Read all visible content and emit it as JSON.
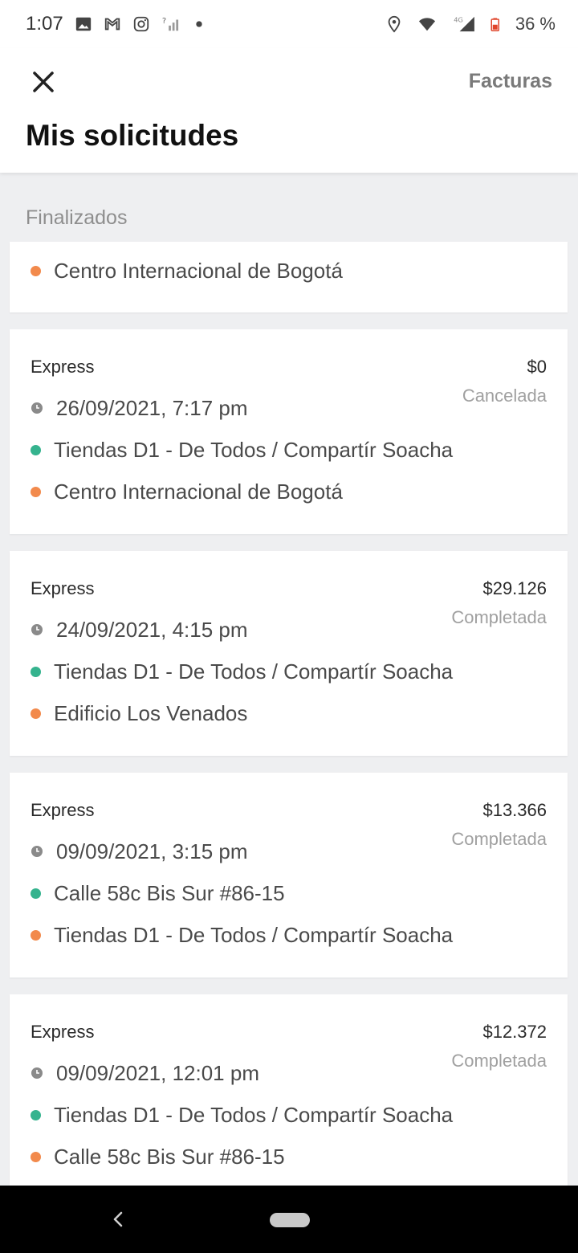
{
  "status_bar": {
    "time": "1:07",
    "battery_text": "36 %",
    "network": "4G",
    "left_icons": [
      "image-icon",
      "gmail-icon",
      "instagram-icon",
      "no-signal-icon",
      "dot-icon"
    ],
    "right_icons": [
      "location-icon",
      "wifi-icon",
      "signal-icon",
      "battery-icon"
    ]
  },
  "header": {
    "close_icon": "close-icon",
    "facturas_label": "Facturas",
    "title": "Mis solicitudes"
  },
  "section": {
    "label": "Finalizados"
  },
  "partial_card": {
    "destination": "Centro Internacional de Bogotá"
  },
  "cards": [
    {
      "type": "Express",
      "price": "$0",
      "status": "Cancelada",
      "datetime": "26/09/2021, 7:17 pm",
      "origin": "Tiendas D1 - De Todos / Compartír Soacha",
      "destination": "Centro Internacional de Bogotá"
    },
    {
      "type": "Express",
      "price": "$29.126",
      "status": "Completada",
      "datetime": "24/09/2021, 4:15 pm",
      "origin": "Tiendas D1 - De Todos / Compartír Soacha",
      "destination": "Edificio Los Venados"
    },
    {
      "type": "Express",
      "price": "$13.366",
      "status": "Completada",
      "datetime": "09/09/2021, 3:15 pm",
      "origin": "Calle 58c Bis Sur #86-15",
      "destination": "Tiendas D1 - De Todos / Compartír Soacha"
    },
    {
      "type": "Express",
      "price": "$12.372",
      "status": "Completada",
      "datetime": "09/09/2021, 12:01 pm",
      "origin": "Tiendas D1 - De Todos / Compartír Soacha",
      "destination": "Calle 58c Bis Sur #86-15"
    }
  ],
  "colors": {
    "origin_dot": "#35b38e",
    "destination_dot": "#f28a4c",
    "status_text": "#a0a0a0",
    "background": "#eeeff1"
  },
  "nav_bar": {
    "back_icon": "back-icon",
    "home_icon": "home-pill-icon"
  }
}
